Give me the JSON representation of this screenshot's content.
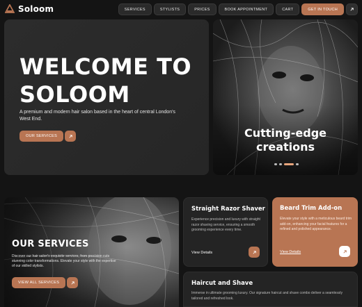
{
  "brand": {
    "name": "Soloom",
    "accent": "#b87553"
  },
  "nav": {
    "links": [
      "SERVICES",
      "STYLISTS",
      "PRICES",
      "BOOK APPOINTMENT",
      "CART"
    ],
    "cta": "GET IN TOUCH",
    "cta_icon": "arrow-up-right-icon"
  },
  "hero": {
    "title_line1": "WELCOME TO",
    "title_line2": "SOLOOM",
    "description": "A premium and modern hair salon based in the heart of central London's West End.",
    "button": "OUR SERVICES",
    "image_caption_line1": "Cutting-edge",
    "image_caption_line2": "creations"
  },
  "services": {
    "title": "OUR SERVICES",
    "description": "Discover our hair salon's exquisite services, from precision cuts stunning color transformations. Elevate your style with the expertise of our skilled stylists.",
    "button": "VIEW ALL SERVICES",
    "cards": [
      {
        "title": "Straight Razor Shaver",
        "description": "Experience precision and luxury with straight razor shaving service, ensuring a smooth grooming experience every time.",
        "link": "View Details"
      },
      {
        "title": "Beard Trim Add-on",
        "description": "Elevate your style with a meticulous beard trim add-on, enhancing your facial features for a refined and polished appearance.",
        "link": "View Details"
      },
      {
        "title": "Haircut and Shave",
        "description": "Immerse in ultimate grooming luxury. Our signature haircut and shave combo deliver a seamlessly tailored and refreshed look."
      }
    ]
  }
}
